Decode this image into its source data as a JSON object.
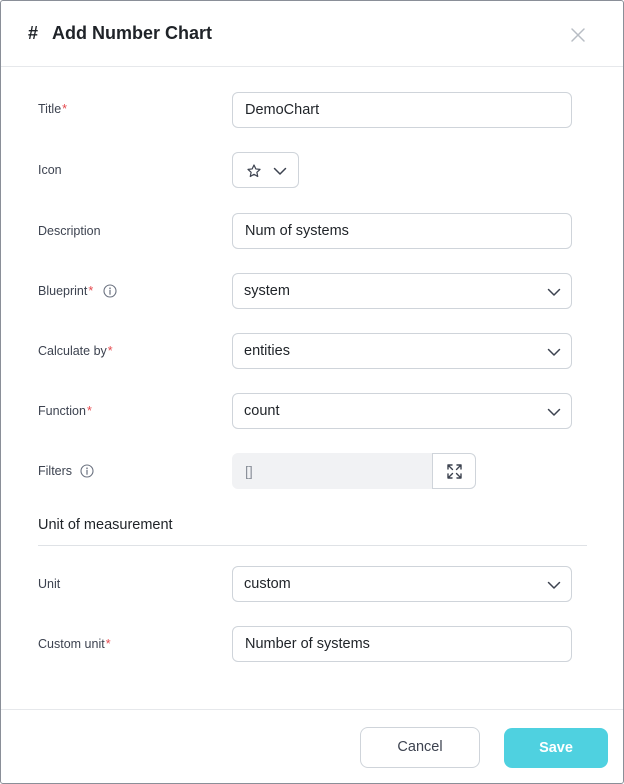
{
  "dialog": {
    "hash_symbol": "#",
    "title": "Add Number Chart"
  },
  "form": {
    "title": {
      "label": "Title",
      "required_mark": "*",
      "value": "DemoChart"
    },
    "icon": {
      "label": "Icon",
      "value_icon": "star-icon"
    },
    "description": {
      "label": "Description",
      "value": "Num of systems"
    },
    "blueprint": {
      "label": "Blueprint",
      "required_mark": "*",
      "value": "system"
    },
    "calculate_by": {
      "label": "Calculate by",
      "required_mark": "*",
      "value": "entities"
    },
    "function": {
      "label": "Function",
      "required_mark": "*",
      "value": "count"
    },
    "filters": {
      "label": "Filters",
      "value": "[]"
    }
  },
  "unit_section": {
    "title": "Unit of measurement",
    "unit": {
      "label": "Unit",
      "value": "custom"
    },
    "custom_unit": {
      "label": "Custom unit",
      "required_mark": "*",
      "value": "Number of systems"
    }
  },
  "footer": {
    "cancel_label": "Cancel",
    "save_label": "Save"
  },
  "colors": {
    "accent": "#4fd1e0",
    "required": "#e5484d",
    "border": "#cfd4da"
  }
}
